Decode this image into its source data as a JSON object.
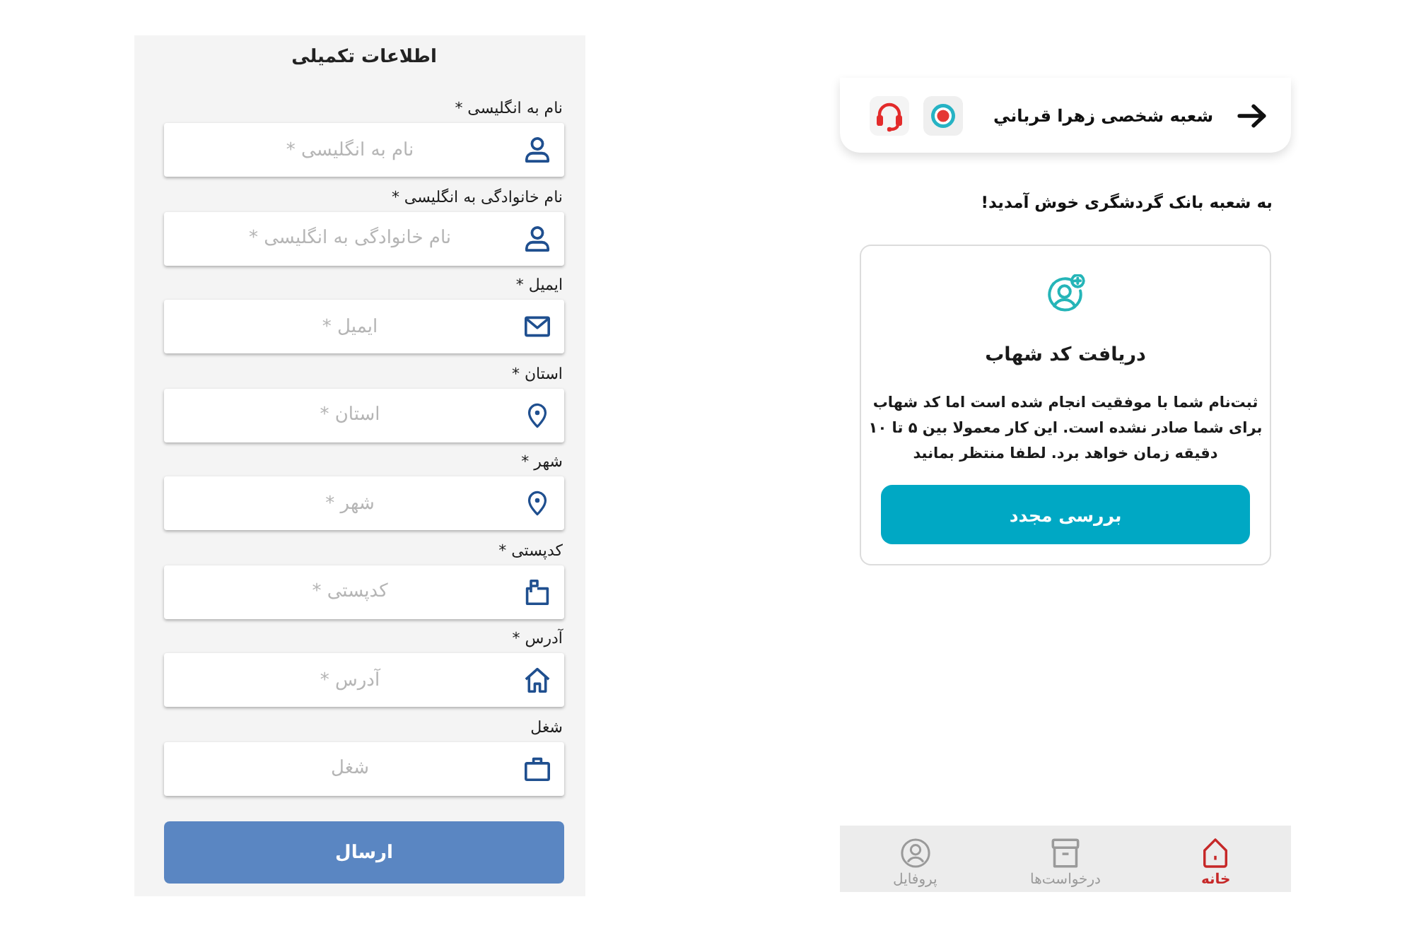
{
  "form_panel": {
    "title": "اطلاعات تکمیلی",
    "fields": [
      {
        "kind": "name",
        "label": "نام به انگلیسی *",
        "placeholder": "نام به انگلیسی *"
      },
      {
        "kind": "name",
        "label": "نام خانوادگی به انگلیسی *",
        "placeholder": "نام خانوادگی به انگلیسی *"
      },
      {
        "kind": "email",
        "label": "ایمیل *",
        "placeholder": "ایمیل *"
      },
      {
        "kind": "location",
        "label": "استان *",
        "placeholder": "استان *"
      },
      {
        "kind": "location",
        "label": "شهر *",
        "placeholder": "شهر *"
      },
      {
        "kind": "postal",
        "label": "کدپستی *",
        "placeholder": "کدپستی *"
      },
      {
        "kind": "address",
        "label": "آدرس *",
        "placeholder": "آدرس *"
      },
      {
        "kind": "job",
        "label": "شغل",
        "placeholder": "شغل"
      }
    ],
    "submit_button": "ارسال"
  },
  "branch_screen": {
    "header": {
      "title": "شعبه شخصی زهرا قرباني"
    },
    "welcome": "به شعبه بانک گردشگری خوش آمدید!",
    "card": {
      "title": "دریافت کد شهاب",
      "message": "ثبت‌نام شما با موفقیت انجام شده است اما کد شهاب برای شما صادر نشده است. این کار معمولا بین ۵ تا ۱۰ دقیقه زمان خواهد برد. لطفا منتظر بمانید",
      "button": "بررسی مجدد"
    },
    "bottom_nav": [
      {
        "kind": "home",
        "label": "خانه",
        "selected": true
      },
      {
        "kind": "requests",
        "label": "درخواست‌ها",
        "selected": false
      },
      {
        "kind": "profile",
        "label": "پروفایل",
        "selected": false
      }
    ]
  }
}
